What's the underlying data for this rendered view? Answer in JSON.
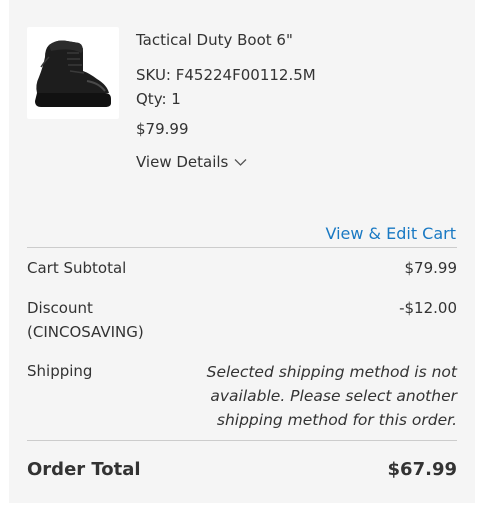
{
  "item": {
    "name": "Tactical Duty Boot 6\"",
    "sku": "SKU: F45224F00112.5M",
    "qty": "Qty: 1",
    "price": "$79.99",
    "details_label": "View Details",
    "image_icon": "boot-product-image"
  },
  "cart_link": "View & Edit Cart",
  "summary": {
    "subtotal_label": "Cart Subtotal",
    "subtotal_value": "$79.99",
    "discount_label_line1": "Discount",
    "discount_label_line2": "(CINCOSAVING)",
    "discount_value": "-$12.00",
    "shipping_label": "Shipping",
    "shipping_message": "Selected shipping method is not available. Please select another shipping method for this order.",
    "total_label": "Order Total",
    "total_value": "$67.99"
  },
  "colors": {
    "link": "#1979c3",
    "panel_bg": "#f5f5f5",
    "text": "#333333"
  }
}
